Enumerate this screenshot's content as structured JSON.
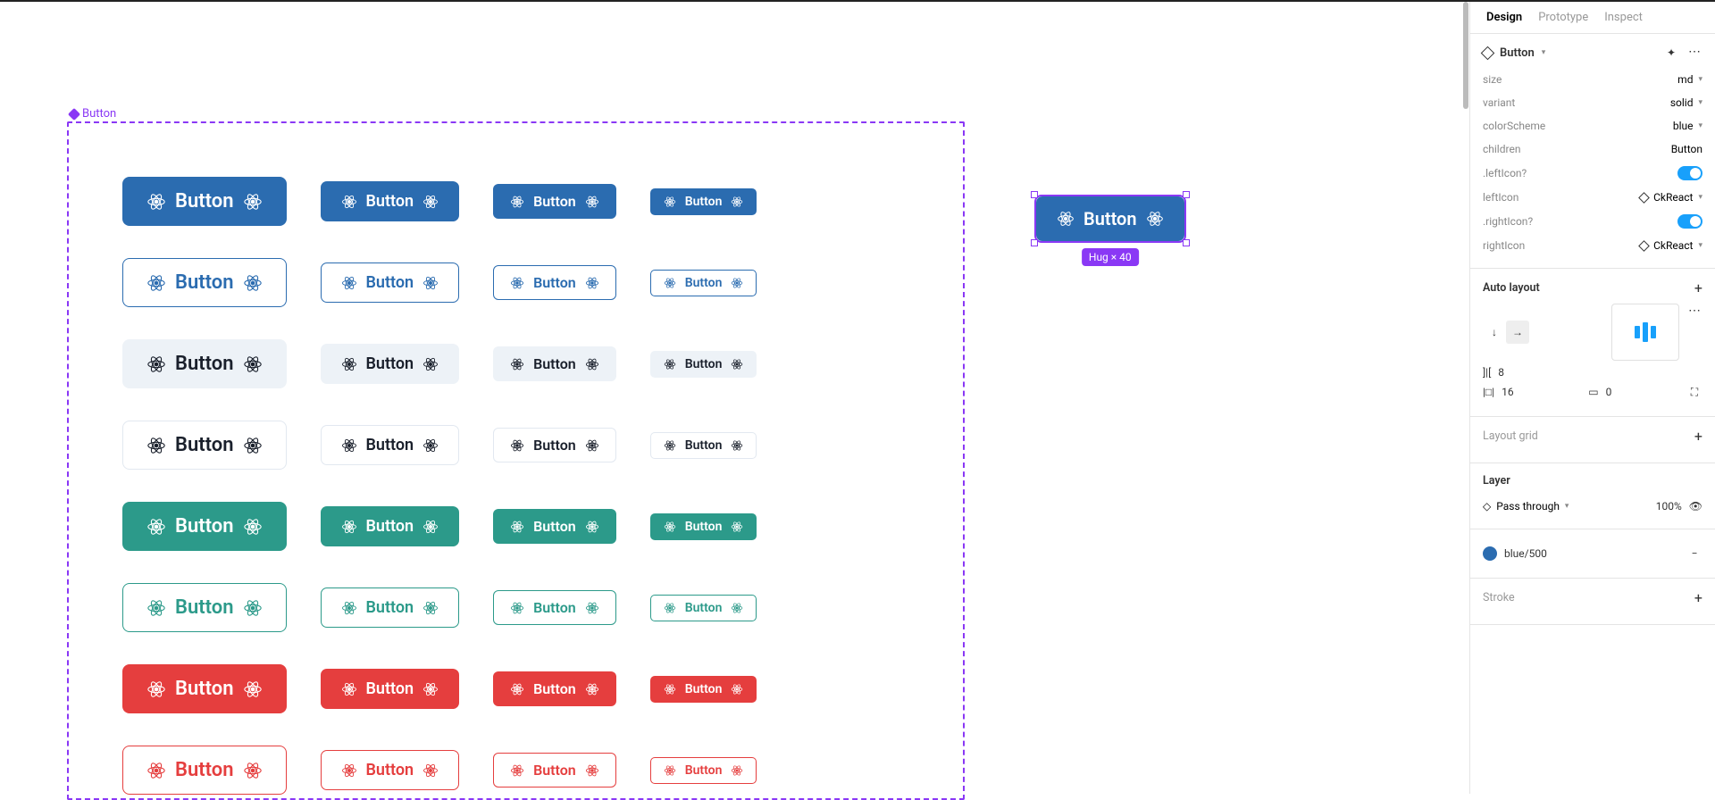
{
  "tabs": {
    "design": "Design",
    "prototype": "Prototype",
    "inspect": "Inspect"
  },
  "frame": {
    "label": "Button",
    "selection_badge": "Hug × 40"
  },
  "button_label": "Button",
  "component": {
    "name": "Button",
    "props": {
      "size": {
        "label": "size",
        "value": "md"
      },
      "variant": {
        "label": "variant",
        "value": "solid"
      },
      "colorScheme": {
        "label": "colorScheme",
        "value": "blue"
      },
      "children": {
        "label": "children",
        "value": "Button"
      },
      "leftIconQ": {
        "label": ".leftIcon?",
        "on": true
      },
      "leftIcon": {
        "label": "leftIcon",
        "value": "CkReact"
      },
      "rightIconQ": {
        "label": ".rightIcon?",
        "on": true
      },
      "rightIcon": {
        "label": "rightIcon",
        "value": "CkReact"
      }
    }
  },
  "autolayout": {
    "title": "Auto layout",
    "gap": "8",
    "padding_h": "16",
    "padding_v": "0"
  },
  "layout_grid": {
    "title": "Layout grid"
  },
  "layer": {
    "title": "Layer",
    "blend": "Pass through",
    "opacity": "100%"
  },
  "fill": {
    "label": "blue/500"
  },
  "stroke": {
    "title": "Stroke"
  }
}
